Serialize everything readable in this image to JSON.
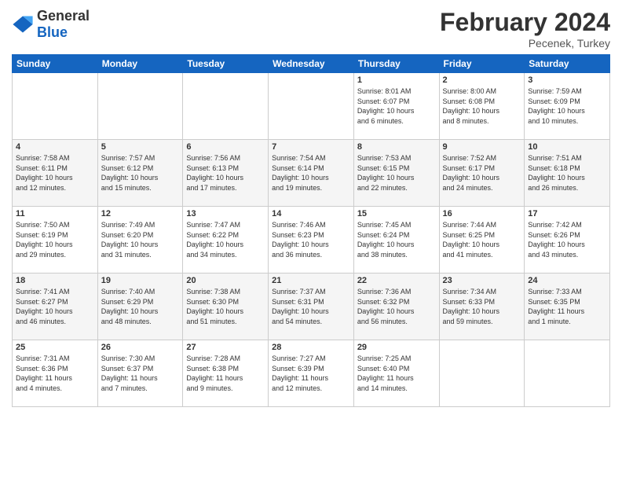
{
  "header": {
    "logo_general": "General",
    "logo_blue": "Blue",
    "month_year": "February 2024",
    "location": "Pecenek, Turkey"
  },
  "days_of_week": [
    "Sunday",
    "Monday",
    "Tuesday",
    "Wednesday",
    "Thursday",
    "Friday",
    "Saturday"
  ],
  "weeks": [
    [
      {
        "day": "",
        "info": ""
      },
      {
        "day": "",
        "info": ""
      },
      {
        "day": "",
        "info": ""
      },
      {
        "day": "",
        "info": ""
      },
      {
        "day": "1",
        "info": "Sunrise: 8:01 AM\nSunset: 6:07 PM\nDaylight: 10 hours\nand 6 minutes."
      },
      {
        "day": "2",
        "info": "Sunrise: 8:00 AM\nSunset: 6:08 PM\nDaylight: 10 hours\nand 8 minutes."
      },
      {
        "day": "3",
        "info": "Sunrise: 7:59 AM\nSunset: 6:09 PM\nDaylight: 10 hours\nand 10 minutes."
      }
    ],
    [
      {
        "day": "4",
        "info": "Sunrise: 7:58 AM\nSunset: 6:11 PM\nDaylight: 10 hours\nand 12 minutes."
      },
      {
        "day": "5",
        "info": "Sunrise: 7:57 AM\nSunset: 6:12 PM\nDaylight: 10 hours\nand 15 minutes."
      },
      {
        "day": "6",
        "info": "Sunrise: 7:56 AM\nSunset: 6:13 PM\nDaylight: 10 hours\nand 17 minutes."
      },
      {
        "day": "7",
        "info": "Sunrise: 7:54 AM\nSunset: 6:14 PM\nDaylight: 10 hours\nand 19 minutes."
      },
      {
        "day": "8",
        "info": "Sunrise: 7:53 AM\nSunset: 6:15 PM\nDaylight: 10 hours\nand 22 minutes."
      },
      {
        "day": "9",
        "info": "Sunrise: 7:52 AM\nSunset: 6:17 PM\nDaylight: 10 hours\nand 24 minutes."
      },
      {
        "day": "10",
        "info": "Sunrise: 7:51 AM\nSunset: 6:18 PM\nDaylight: 10 hours\nand 26 minutes."
      }
    ],
    [
      {
        "day": "11",
        "info": "Sunrise: 7:50 AM\nSunset: 6:19 PM\nDaylight: 10 hours\nand 29 minutes."
      },
      {
        "day": "12",
        "info": "Sunrise: 7:49 AM\nSunset: 6:20 PM\nDaylight: 10 hours\nand 31 minutes."
      },
      {
        "day": "13",
        "info": "Sunrise: 7:47 AM\nSunset: 6:22 PM\nDaylight: 10 hours\nand 34 minutes."
      },
      {
        "day": "14",
        "info": "Sunrise: 7:46 AM\nSunset: 6:23 PM\nDaylight: 10 hours\nand 36 minutes."
      },
      {
        "day": "15",
        "info": "Sunrise: 7:45 AM\nSunset: 6:24 PM\nDaylight: 10 hours\nand 38 minutes."
      },
      {
        "day": "16",
        "info": "Sunrise: 7:44 AM\nSunset: 6:25 PM\nDaylight: 10 hours\nand 41 minutes."
      },
      {
        "day": "17",
        "info": "Sunrise: 7:42 AM\nSunset: 6:26 PM\nDaylight: 10 hours\nand 43 minutes."
      }
    ],
    [
      {
        "day": "18",
        "info": "Sunrise: 7:41 AM\nSunset: 6:27 PM\nDaylight: 10 hours\nand 46 minutes."
      },
      {
        "day": "19",
        "info": "Sunrise: 7:40 AM\nSunset: 6:29 PM\nDaylight: 10 hours\nand 48 minutes."
      },
      {
        "day": "20",
        "info": "Sunrise: 7:38 AM\nSunset: 6:30 PM\nDaylight: 10 hours\nand 51 minutes."
      },
      {
        "day": "21",
        "info": "Sunrise: 7:37 AM\nSunset: 6:31 PM\nDaylight: 10 hours\nand 54 minutes."
      },
      {
        "day": "22",
        "info": "Sunrise: 7:36 AM\nSunset: 6:32 PM\nDaylight: 10 hours\nand 56 minutes."
      },
      {
        "day": "23",
        "info": "Sunrise: 7:34 AM\nSunset: 6:33 PM\nDaylight: 10 hours\nand 59 minutes."
      },
      {
        "day": "24",
        "info": "Sunrise: 7:33 AM\nSunset: 6:35 PM\nDaylight: 11 hours\nand 1 minute."
      }
    ],
    [
      {
        "day": "25",
        "info": "Sunrise: 7:31 AM\nSunset: 6:36 PM\nDaylight: 11 hours\nand 4 minutes."
      },
      {
        "day": "26",
        "info": "Sunrise: 7:30 AM\nSunset: 6:37 PM\nDaylight: 11 hours\nand 7 minutes."
      },
      {
        "day": "27",
        "info": "Sunrise: 7:28 AM\nSunset: 6:38 PM\nDaylight: 11 hours\nand 9 minutes."
      },
      {
        "day": "28",
        "info": "Sunrise: 7:27 AM\nSunset: 6:39 PM\nDaylight: 11 hours\nand 12 minutes."
      },
      {
        "day": "29",
        "info": "Sunrise: 7:25 AM\nSunset: 6:40 PM\nDaylight: 11 hours\nand 14 minutes."
      },
      {
        "day": "",
        "info": ""
      },
      {
        "day": "",
        "info": ""
      }
    ]
  ]
}
